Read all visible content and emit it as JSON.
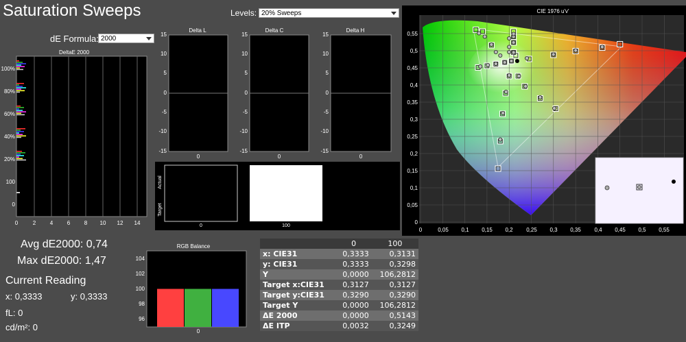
{
  "title": "Saturation Sweeps",
  "levels": {
    "label": "Levels:",
    "value": "20% Sweeps"
  },
  "de_formula": {
    "label": "dE Formula:",
    "value": "2000"
  },
  "deltaE_chart": {
    "title": "DeltaE 2000",
    "ytick_labels": [
      "100%",
      "80%",
      "60%",
      "40%",
      "20%",
      "100",
      "0"
    ],
    "xtick_labels": [
      "0",
      "2",
      "4",
      "6",
      "8",
      "10",
      "12",
      "14"
    ]
  },
  "delta_charts": [
    {
      "title": "Delta L",
      "ytick_labels": [
        "15",
        "10",
        "5",
        "0",
        "-5",
        "-10",
        "-15"
      ],
      "xlabel": "0"
    },
    {
      "title": "Delta C",
      "ytick_labels": [
        "15",
        "10",
        "5",
        "0",
        "-5",
        "-10",
        "-15"
      ],
      "xlabel": "0"
    },
    {
      "title": "Delta H",
      "ytick_labels": [
        "15",
        "10",
        "5",
        "0",
        "-5",
        "-10",
        "-15"
      ],
      "xlabel": "0"
    }
  ],
  "swatches": {
    "actual_label": "Actual",
    "target_label": "Target",
    "left_value": "0",
    "right_value": "100"
  },
  "cie": {
    "title": "CIE 1976 u'v'",
    "xtick_labels": [
      "0",
      "0,05",
      "0,1",
      "0,15",
      "0,2",
      "0,25",
      "0,3",
      "0,35",
      "0,4",
      "0,45",
      "0,5",
      "0,55"
    ],
    "ytick_labels": [
      "0,55",
      "0,5",
      "0,45",
      "0,4",
      "0,35",
      "0,3",
      "0,25",
      "0,2",
      "0,15",
      "0,1",
      "0,05",
      "0"
    ]
  },
  "summary": {
    "avg": "Avg dE2000: 0,74",
    "max": "Max dE2000: 1,47",
    "current_reading": "Current Reading",
    "x": "x: 0,3333",
    "y": "y: 0,3333",
    "fl": "fL: 0",
    "cdm2": "cd/m²: 0"
  },
  "rgb_balance": {
    "title": "RGB Balance",
    "ytick_labels": [
      "104",
      "102",
      "100",
      "98",
      "96"
    ],
    "xlabel": "0",
    "colors": {
      "red": "#ff4040",
      "green": "#40b040",
      "blue": "#4848ff"
    }
  },
  "readings": {
    "headers": [
      "",
      "0",
      "100"
    ],
    "rows": [
      [
        "x: CIE31",
        "0,3333",
        "0,3131"
      ],
      [
        "y: CIE31",
        "0,3333",
        "0,3298"
      ],
      [
        "Y",
        "0,0000",
        "106,2812"
      ],
      [
        "Target x:CIE31",
        "0,3127",
        "0,3127"
      ],
      [
        "Target y:CIE31",
        "0,3290",
        "0,3290"
      ],
      [
        "Target Y",
        "0,0000",
        "106,2812"
      ],
      [
        "ΔE 2000",
        "0,0000",
        "0,5143"
      ],
      [
        "ΔE ITP",
        "0,0032",
        "0,3249"
      ]
    ]
  },
  "chart_data": [
    {
      "type": "bar",
      "title": "RGB Balance",
      "categories": [
        "0"
      ],
      "series": [
        {
          "name": "Red",
          "values": [
            100
          ]
        },
        {
          "name": "Green",
          "values": [
            100
          ]
        },
        {
          "name": "Blue",
          "values": [
            100
          ]
        }
      ],
      "ylim": [
        95,
        105
      ]
    },
    {
      "type": "scatter",
      "title": "CIE 1976 u'v'",
      "xlim": [
        0,
        0.6
      ],
      "ylim": [
        0,
        0.6
      ],
      "targets": [
        [
          0.205,
          0.474
        ],
        [
          0.21,
          0.499
        ],
        [
          0.21,
          0.528
        ],
        [
          0.21,
          0.545
        ],
        [
          0.21,
          0.56
        ],
        [
          0.19,
          0.47
        ],
        [
          0.17,
          0.465
        ],
        [
          0.15,
          0.46
        ],
        [
          0.13,
          0.455
        ],
        [
          0.2,
          0.43
        ],
        [
          0.192,
          0.38
        ],
        [
          0.185,
          0.32
        ],
        [
          0.18,
          0.24
        ],
        [
          0.175,
          0.16
        ],
        [
          0.22,
          0.43
        ],
        [
          0.235,
          0.4
        ],
        [
          0.27,
          0.365
        ],
        [
          0.305,
          0.335
        ],
        [
          0.215,
          0.49
        ],
        [
          0.245,
          0.48
        ],
        [
          0.3,
          0.492
        ],
        [
          0.35,
          0.503
        ],
        [
          0.41,
          0.513
        ],
        [
          0.45,
          0.523
        ],
        [
          0.16,
          0.52
        ],
        [
          0.14,
          0.56
        ],
        [
          0.125,
          0.565
        ]
      ],
      "measured": [
        [
          0.205,
          0.474
        ],
        [
          0.21,
          0.499
        ],
        [
          0.21,
          0.528
        ],
        [
          0.21,
          0.545
        ],
        [
          0.21,
          0.553
        ],
        [
          0.19,
          0.47
        ],
        [
          0.17,
          0.466
        ],
        [
          0.152,
          0.462
        ],
        [
          0.135,
          0.458
        ],
        [
          0.2,
          0.432
        ],
        [
          0.193,
          0.384
        ],
        [
          0.186,
          0.322
        ],
        [
          0.18,
          0.245
        ],
        [
          0.222,
          0.43
        ],
        [
          0.237,
          0.4
        ],
        [
          0.27,
          0.368
        ],
        [
          0.302,
          0.336
        ],
        [
          0.24,
          0.482
        ],
        [
          0.3,
          0.493
        ],
        [
          0.35,
          0.505
        ],
        [
          0.41,
          0.515
        ],
        [
          0.16,
          0.522
        ],
        [
          0.145,
          0.545
        ],
        [
          0.132,
          0.555
        ],
        [
          0.2,
          0.5
        ],
        [
          0.2,
          0.515
        ],
        [
          0.2,
          0.54
        ],
        [
          0.18,
          0.49
        ],
        [
          0.17,
          0.5
        ]
      ],
      "whitepoint": [
        0.212,
        0.474
      ]
    }
  ]
}
